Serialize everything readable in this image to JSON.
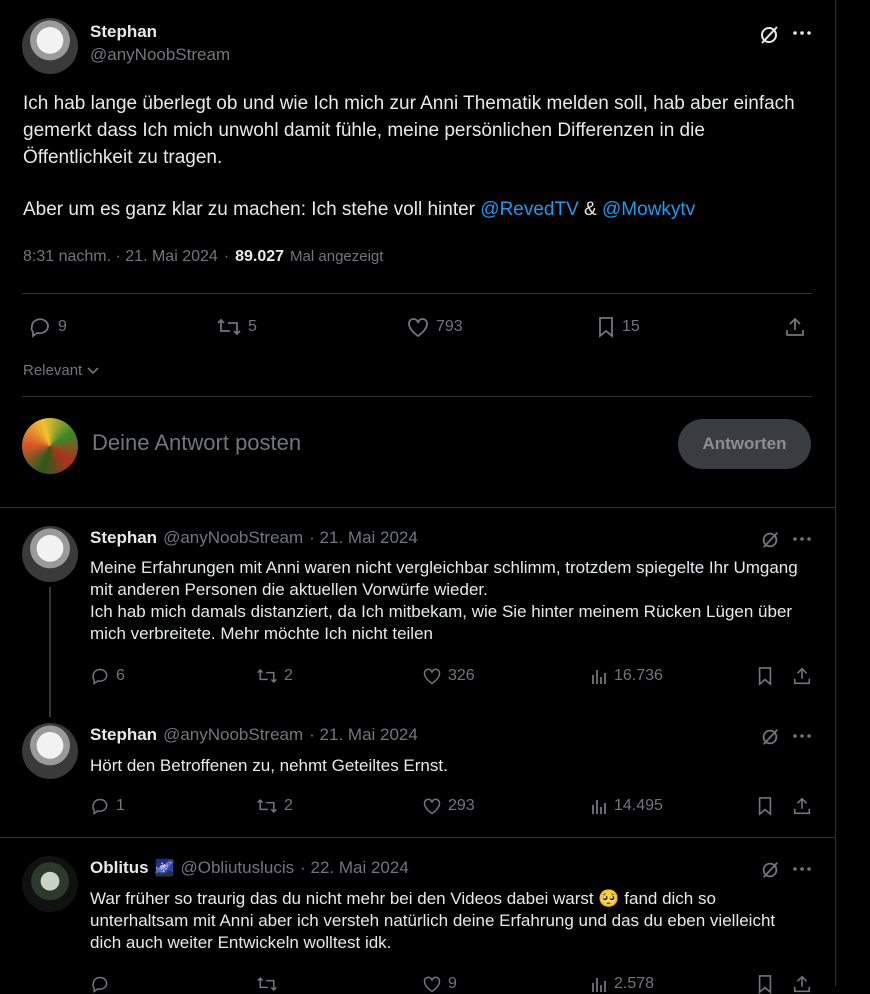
{
  "main_tweet": {
    "author_name": "Stephan",
    "author_handle": "@anyNoobStream",
    "text_p1": "Ich hab lange überlegt ob und wie Ich mich zur Anni Thematik melden soll, hab aber einfach",
    "text_p2": "gemerkt dass Ich mich unwohl damit fühle, meine persönlichen Differenzen in die",
    "text_p3": "Öffentlichkeit zu tragen.",
    "text_p4_prefix": "Aber um es ganz klar zu machen: Ich stehe voll hinter ",
    "mention_1": "@RevedTV",
    "amp": " & ",
    "mention_2": "@Mowkytv",
    "time": "8:31 nachm. · 21. Mai 2024",
    "dot": "·",
    "views": "89.027",
    "views_label": "Mal angezeigt",
    "replies": "9",
    "retweets": "5",
    "likes": "793",
    "bookmarks": "15"
  },
  "sort": {
    "label": "Relevant"
  },
  "compose": {
    "placeholder": "Deine Antwort posten",
    "button": "Antworten"
  },
  "replies": [
    {
      "name": "Stephan",
      "handle": "@anyNoobStream",
      "date": "· 21. Mai 2024",
      "lines": [
        "Meine Erfahrungen mit Anni waren nicht vergleichbar schlimm, trotzdem spiegelte Ihr Umgang",
        "mit anderen Personen die aktuellen Vorwürfe wieder.",
        "Ich hab mich damals distanziert, da Ich mitbekam, wie Sie hinter meinem Rücken Lügen über",
        "mich verbreitete. Mehr möchte Ich nicht teilen"
      ],
      "replies": "6",
      "retweets": "2",
      "likes": "326",
      "views": "16.736"
    },
    {
      "name": "Stephan",
      "handle": "@anyNoobStream",
      "date": "· 21. Mai 2024",
      "lines": [
        "Hört den Betroffenen zu, nehmt Geteiltes Ernst."
      ],
      "replies": "1",
      "retweets": "2",
      "likes": "293",
      "views": "14.495"
    },
    {
      "name": "Oblitus",
      "emoji": "🌌",
      "handle": "@Obliutuslucis",
      "date": "· 22. Mai 2024",
      "lines": [
        "War früher so traurig das du nicht mehr bei den Videos dabei warst 🥺 fand dich so",
        "unterhaltsam mit Anni aber ich versteh natürlich deine Erfahrung und das du eben vielleicht",
        "dich auch weiter Entwickeln wolltest idk."
      ],
      "likes": "9",
      "views": "2.578"
    }
  ]
}
